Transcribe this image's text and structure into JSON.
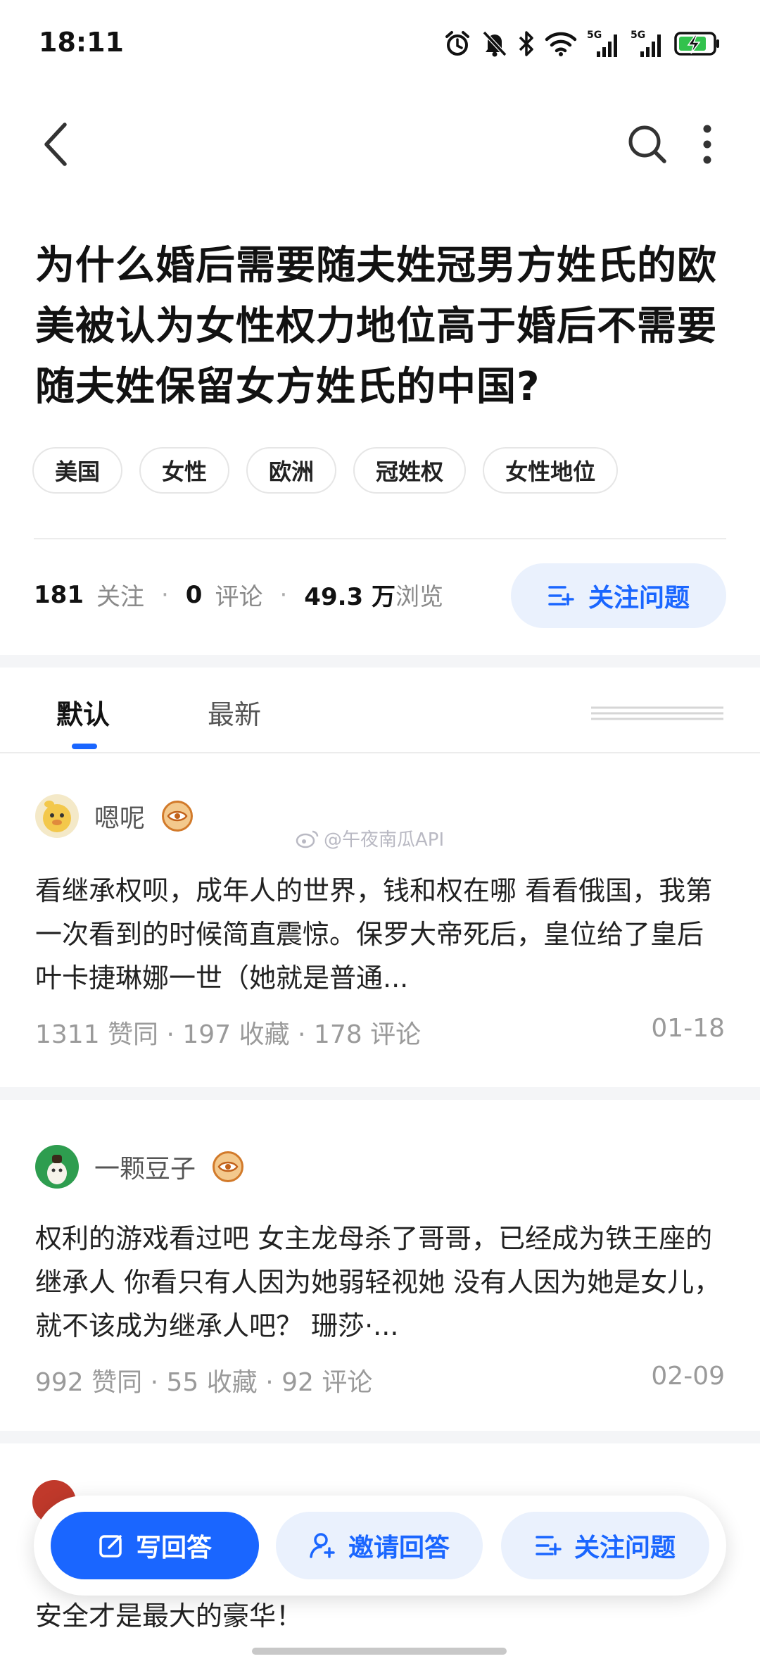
{
  "status_bar": {
    "time": "18:11",
    "icons": [
      "alarm-icon",
      "mute-bell-icon",
      "bluetooth-icon",
      "wifi-icon",
      "signal-5g-icon",
      "signal-5g-icon",
      "battery-charging-icon"
    ],
    "signal_label_1": "5G",
    "signal_label_2": "5G"
  },
  "nav": {
    "back_icon": "chevron-left-icon",
    "search_icon": "search-icon",
    "more_icon": "more-vertical-icon"
  },
  "question": {
    "title": "为什么婚后需要随夫姓冠男方姓氏的欧美被认为女性权力地位高于婚后不需要随夫姓保留女方姓氏的中国?",
    "tags": [
      "美国",
      "女性",
      "欧洲",
      "冠姓权",
      "女性地位"
    ]
  },
  "stats": {
    "follow_count": "181",
    "follow_label": "关注",
    "comment_count": "0",
    "comment_label": "评论",
    "view_count": "49.3 万",
    "view_label": "浏览",
    "follow_button_label": "关注问题"
  },
  "tabs": {
    "default_label": "默认",
    "newest_label": "最新"
  },
  "watermark": "@午夜南瓜API",
  "answers": [
    {
      "author": "嗯呢",
      "text": "看继承权呗，成年人的世界，钱和权在哪 看看俄国，我第一次看到的时候简直震惊。保罗大帝死后，皇位给了皇后叶卡捷琳娜一世（她就是普通...",
      "likes": "1311 赞同",
      "favorites": "197 收藏",
      "comments": "178 评论",
      "date": "01-18"
    },
    {
      "author": "一颗豆子",
      "text": "权利的游戏看过吧 女主龙母杀了哥哥，已经成为铁王座的继承人 你看只有人因为她弱轻视她 没有人因为她是女儿，就不该成为继承人吧？ 珊莎·...",
      "likes": "992 赞同",
      "favorites": "55 收藏",
      "comments": "92 评论",
      "date": "02-09"
    }
  ],
  "partial_answer": {
    "text": "安全才是最大的豪华！"
  },
  "action_bar": {
    "write_label": "写回答",
    "invite_label": "邀请回答",
    "follow_label": "关注问题"
  },
  "colors": {
    "accent": "#1a66ff",
    "accent_light": "#eaf1fd",
    "muted_text": "#9a9a9a"
  }
}
